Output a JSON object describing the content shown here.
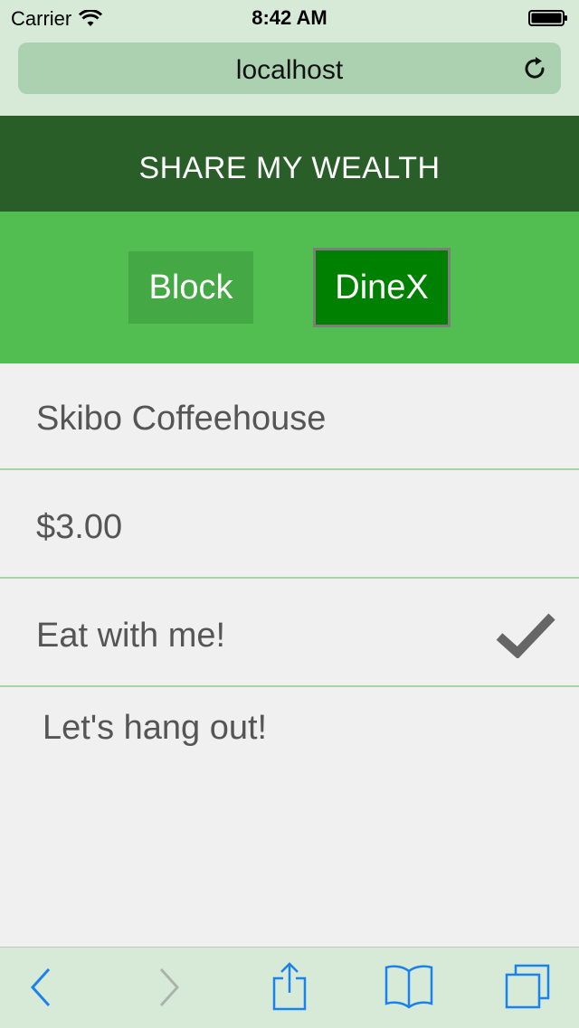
{
  "status_bar": {
    "carrier": "Carrier",
    "time": "8:42 AM",
    "icons": [
      "wifi-icon",
      "battery-icon"
    ]
  },
  "browser": {
    "url": "localhost",
    "reload_icon": "reload-icon"
  },
  "header": {
    "title": "SHARE MY WEALTH"
  },
  "toggle": {
    "options": [
      "Block",
      "DineX"
    ],
    "selected": "DineX"
  },
  "form": {
    "location": "Skibo Coffeehouse",
    "amount": "$3.00",
    "eat_with_me": {
      "label": "Eat with me!",
      "checked": true
    },
    "message": "Let's hang out!"
  },
  "toolbar": {
    "icons": [
      "back-icon",
      "forward-icon",
      "share-icon",
      "bookmarks-icon",
      "tabs-icon"
    ]
  },
  "colors": {
    "header_bg": "#2a5e29",
    "band_bg": "#52be52",
    "selected_btn": "#008000",
    "unselected_btn": "#44a844",
    "divider": "#a6d6a8",
    "ios_blue": "#1a82f0"
  }
}
